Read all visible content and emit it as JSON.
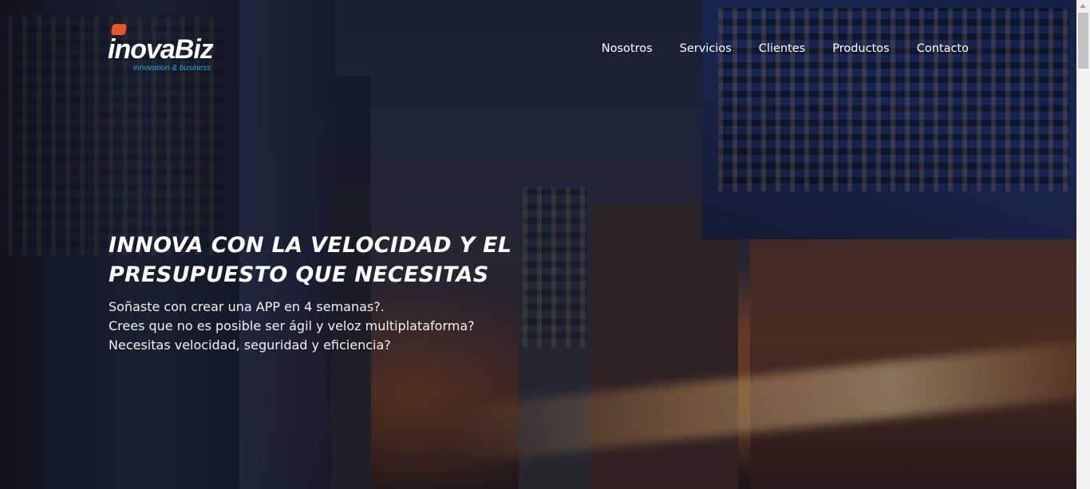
{
  "brand": {
    "name": "inovaBiz",
    "tagline": "innovation & business"
  },
  "nav": {
    "items": [
      {
        "label": "Nosotros"
      },
      {
        "label": "Servicios"
      },
      {
        "label": "Clientes"
      },
      {
        "label": "Productos"
      },
      {
        "label": "Contacto"
      }
    ]
  },
  "hero": {
    "title_line1": "INNOVA CON LA VELOCIDAD Y EL",
    "title_line2": "PRESUPUESTO QUE NECESITAS",
    "lines": [
      "Soñaste con crear una APP en 4 semanas?.",
      "Crees que no es posible ser ágil y veloz multiplataforma?",
      "Necesitas velocidad, seguridad y eficiencia?"
    ],
    "background_image": "city-street-night-photo"
  },
  "colors": {
    "logo_mark": "#e8572a",
    "tagline": "#2b9fe0",
    "text": "#ffffff"
  }
}
